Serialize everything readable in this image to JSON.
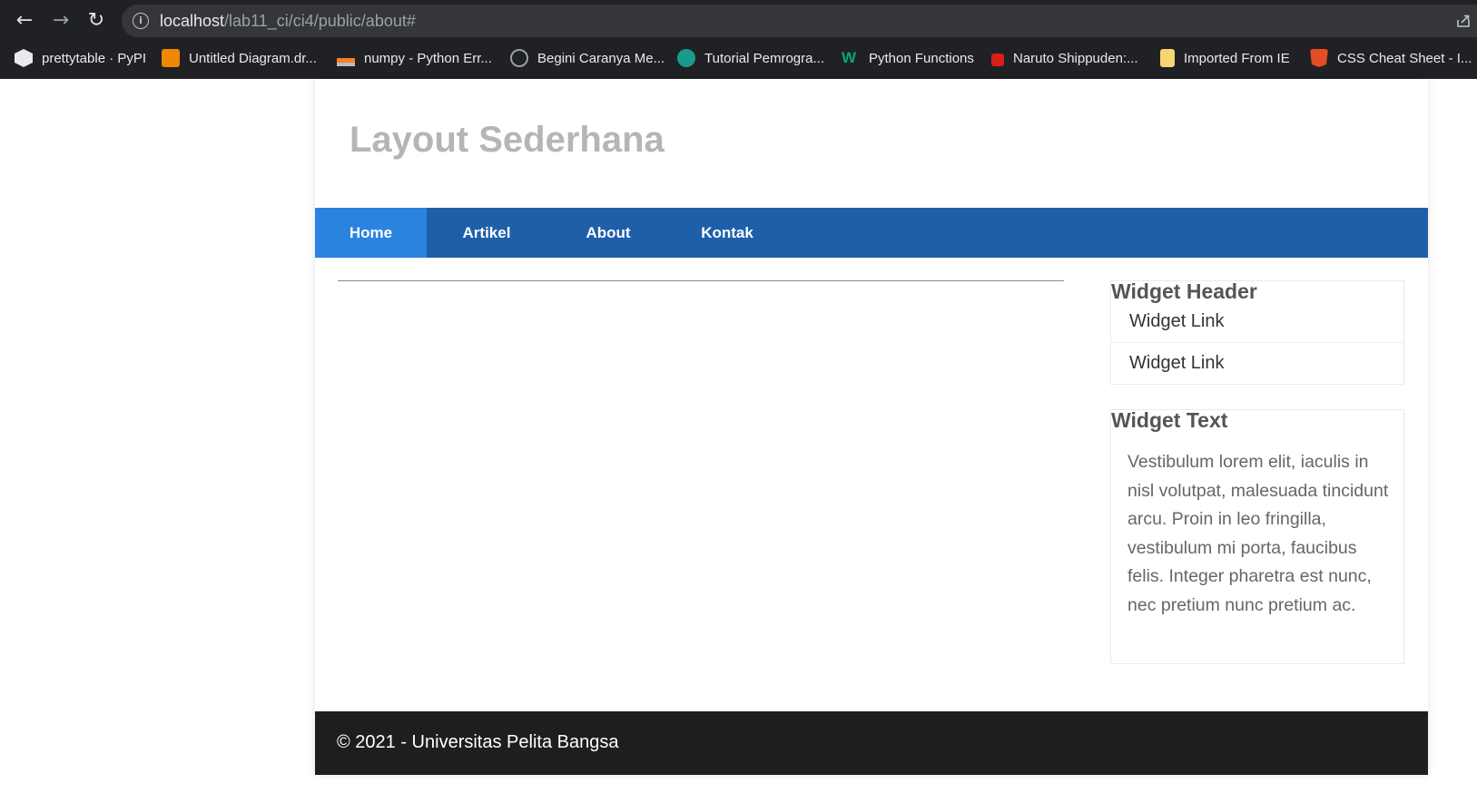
{
  "browser": {
    "url_host": "localhost",
    "url_path": "/lab11_ci/ci4/public/about#",
    "bookmarks": [
      {
        "label": "prettytable · PyPI",
        "icon": "pypi-cube-icon"
      },
      {
        "label": "Untitled Diagram.dr...",
        "icon": "drawio-icon"
      },
      {
        "label": "numpy - Python Err...",
        "icon": "stackoverflow-icon"
      },
      {
        "label": "Begini Caranya Me...",
        "icon": "globe-icon"
      },
      {
        "label": "Tutorial Pemrogra...",
        "icon": "site-logo-icon"
      },
      {
        "label": "Python Functions",
        "icon": "w3schools-icon"
      },
      {
        "label": "Naruto Shippuden:...",
        "icon": "red-lock-icon"
      },
      {
        "label": "Imported From IE",
        "icon": "folder-icon"
      },
      {
        "label": "CSS Cheat Sheet - I...",
        "icon": "css-shield-icon"
      }
    ]
  },
  "site": {
    "title": "Layout Sederhana",
    "nav": [
      {
        "label": "Home",
        "active": true
      },
      {
        "label": "Artikel",
        "active": false
      },
      {
        "label": "About",
        "active": false
      },
      {
        "label": "Kontak",
        "active": false
      }
    ],
    "sidebar": {
      "widget_header": {
        "title": "Widget Header",
        "links": [
          "Widget Link",
          "Widget Link"
        ]
      },
      "widget_text": {
        "title": "Widget Text",
        "body": "Vestibulum lorem elit, iaculis in nisl volutpat, malesuada tincidunt arcu. Proin in leo fringilla, vestibulum mi porta, faucibus felis. Integer pharetra est nunc, nec pretium nunc pretium ac."
      }
    },
    "footer": "© 2021 - Universitas Pelita Bangsa"
  },
  "colors": {
    "nav_bg": "#1f5faa",
    "nav_active": "#2b83e0",
    "footer_bg": "#1e1e1e",
    "title": "#b5b5b5"
  }
}
